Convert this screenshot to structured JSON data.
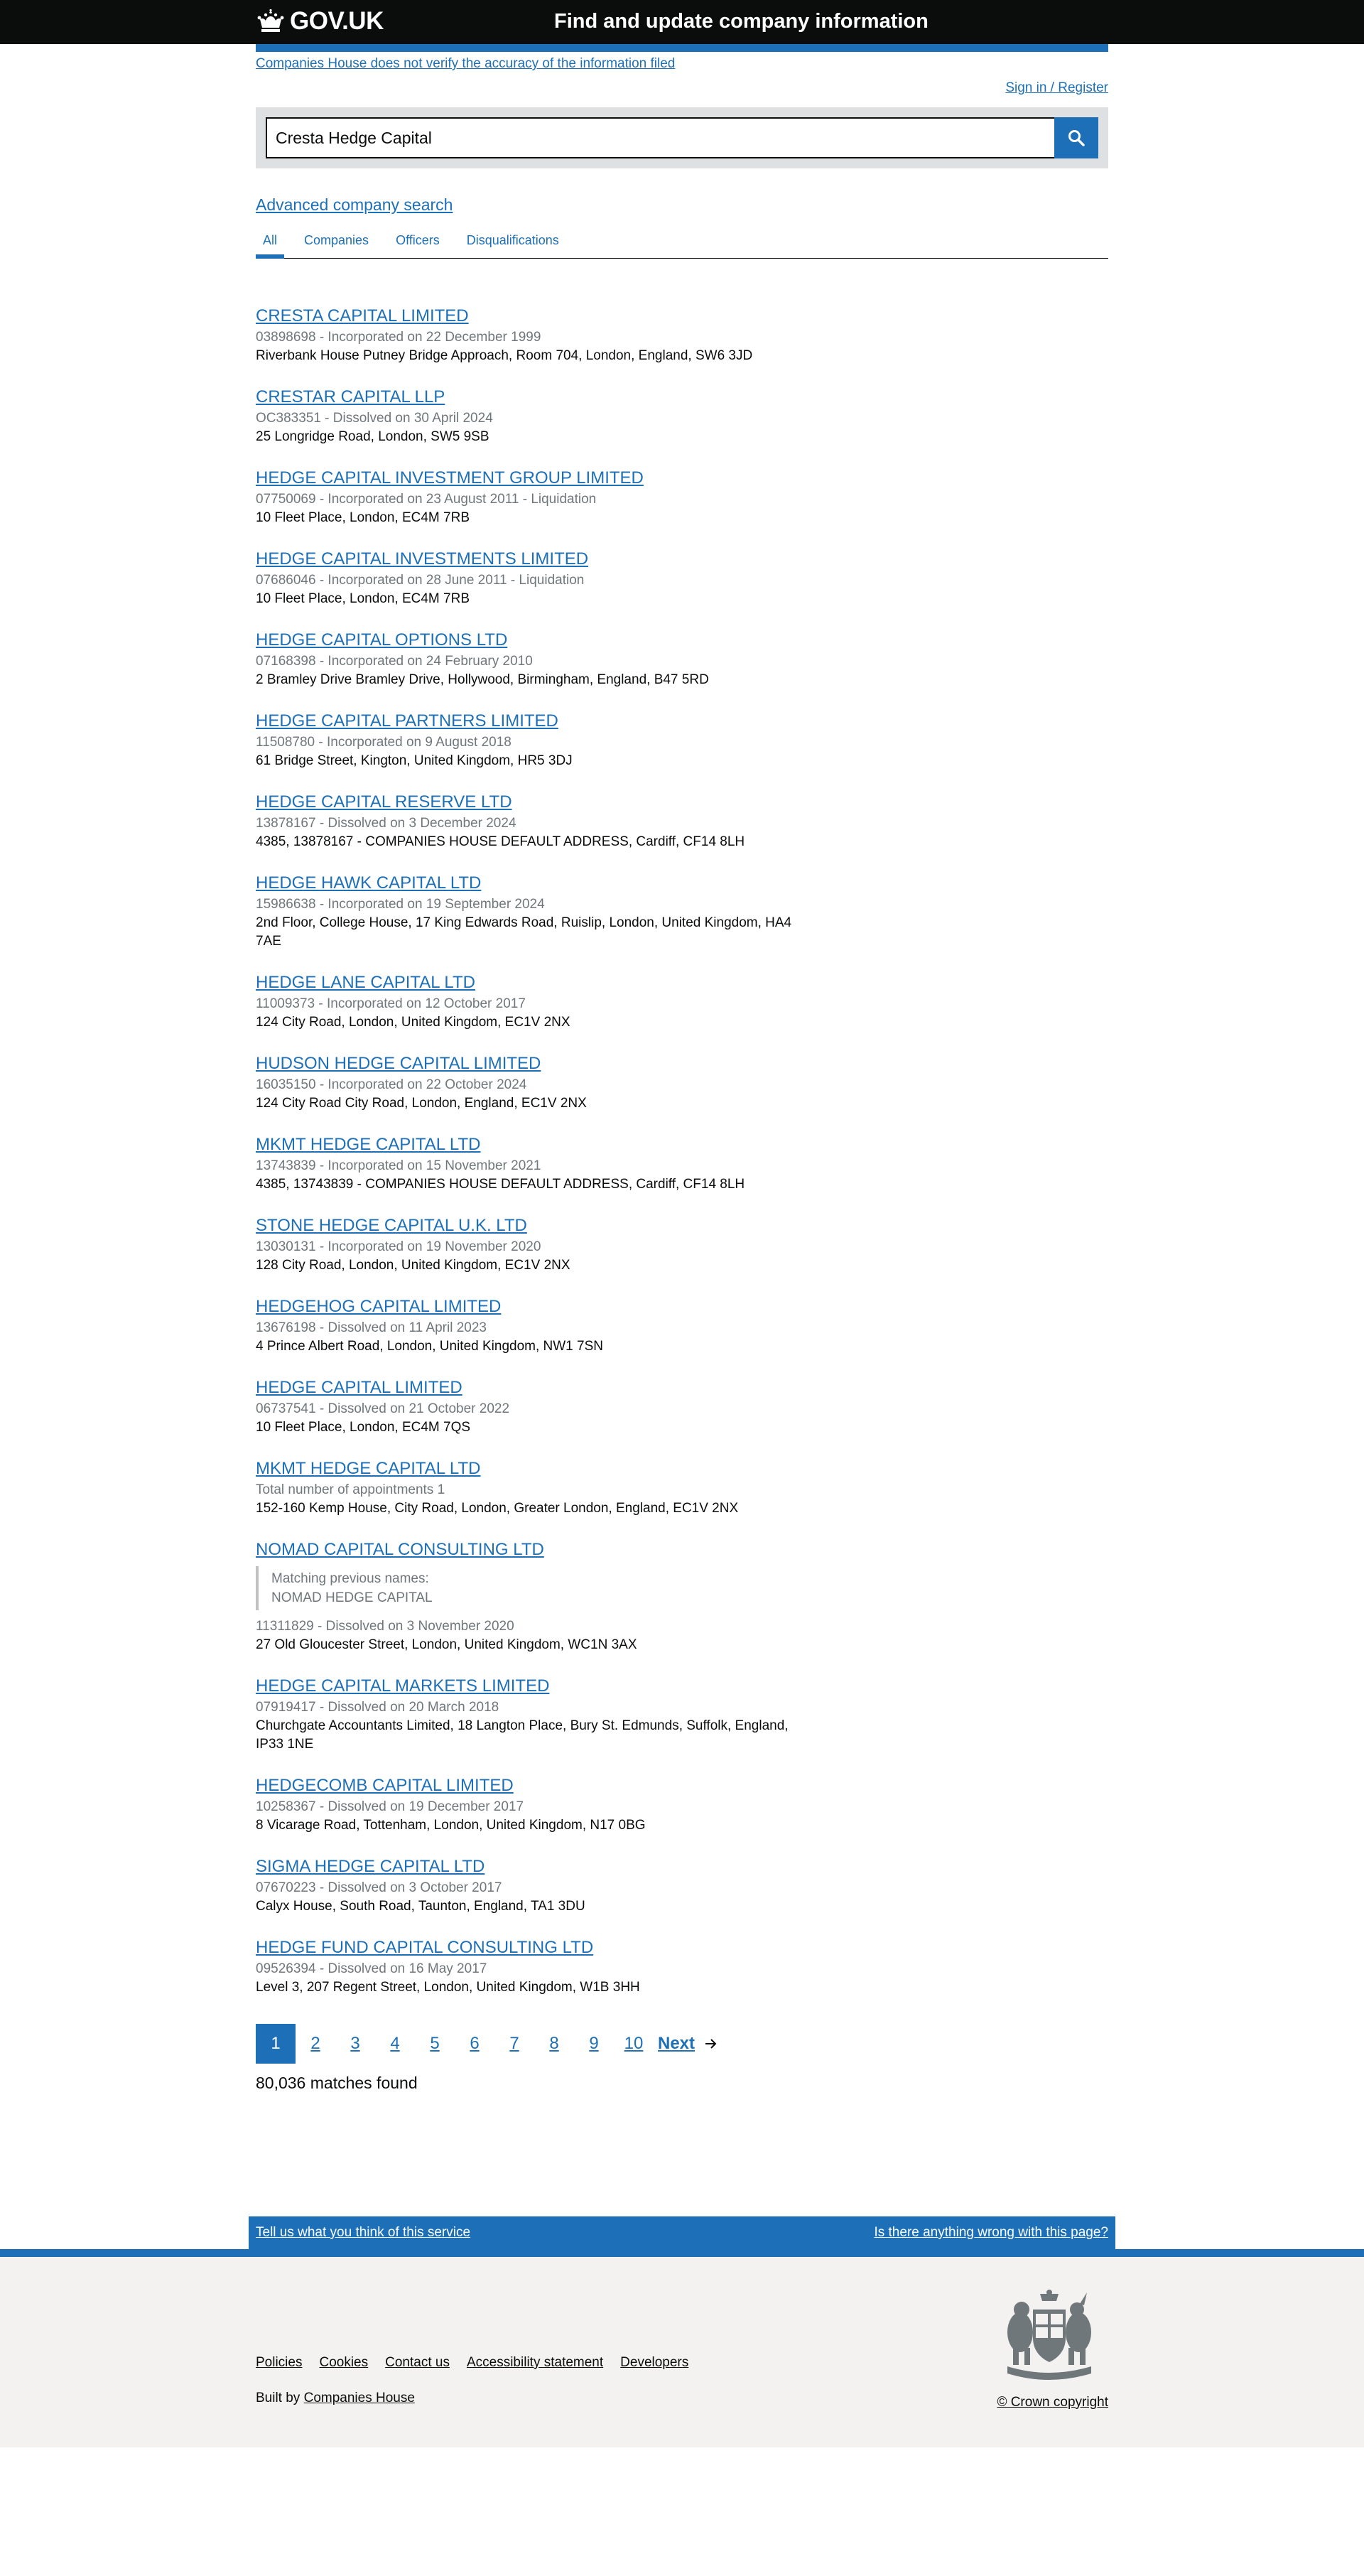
{
  "header": {
    "logo_text": "GOV.UK",
    "service_name": "Find and update company information"
  },
  "banner": {
    "disclaimer": "Companies House does not verify the accuracy of the information filed",
    "sign_in": "Sign in / Register"
  },
  "search": {
    "value": "Cresta Hedge Capital",
    "button_icon": "search-icon"
  },
  "advanced_search": "Advanced company search",
  "tabs": [
    {
      "label": "All",
      "active": true
    },
    {
      "label": "Companies",
      "active": false
    },
    {
      "label": "Officers",
      "active": false
    },
    {
      "label": "Disqualifications",
      "active": false
    }
  ],
  "results": [
    {
      "title": "CRESTA CAPITAL LIMITED",
      "meta": "03898698 - Incorporated on 22 December 1999",
      "address": "Riverbank House Putney Bridge Approach, Room 704, London, England, SW6 3JD"
    },
    {
      "title": "CRESTAR CAPITAL LLP",
      "meta": "OC383351 - Dissolved on 30 April 2024",
      "address": "25 Longridge Road, London, SW5 9SB"
    },
    {
      "title": "HEDGE CAPITAL INVESTMENT GROUP LIMITED",
      "meta": "07750069 - Incorporated on 23 August 2011 - Liquidation",
      "address": "10 Fleet Place, London, EC4M 7RB"
    },
    {
      "title": "HEDGE CAPITAL INVESTMENTS LIMITED",
      "meta": "07686046 - Incorporated on 28 June 2011 - Liquidation",
      "address": "10 Fleet Place, London, EC4M 7RB"
    },
    {
      "title": "HEDGE CAPITAL OPTIONS LTD",
      "meta": "07168398 - Incorporated on 24 February 2010",
      "address": "2 Bramley Drive Bramley Drive, Hollywood, Birmingham, England, B47 5RD"
    },
    {
      "title": "HEDGE CAPITAL PARTNERS LIMITED",
      "meta": "11508780 - Incorporated on 9 August 2018",
      "address": "61 Bridge Street, Kington, United Kingdom, HR5 3DJ"
    },
    {
      "title": "HEDGE CAPITAL RESERVE LTD",
      "meta": "13878167 - Dissolved on 3 December 2024",
      "address": "4385, 13878167 - COMPANIES HOUSE DEFAULT ADDRESS, Cardiff, CF14 8LH"
    },
    {
      "title": "HEDGE HAWK CAPITAL LTD",
      "meta": "15986638 - Incorporated on 19 September 2024",
      "address": "2nd Floor, College House, 17 King Edwards Road, Ruislip, London, United Kingdom, HA4 7AE"
    },
    {
      "title": "HEDGE LANE CAPITAL LTD",
      "meta": "11009373 - Incorporated on 12 October 2017",
      "address": "124 City Road, London, United Kingdom, EC1V 2NX"
    },
    {
      "title": "HUDSON HEDGE CAPITAL LIMITED",
      "meta": "16035150 - Incorporated on 22 October 2024",
      "address": "124 City Road City Road, London, England, EC1V 2NX"
    },
    {
      "title": "MKMT HEDGE CAPITAL LTD",
      "meta": "13743839 - Incorporated on 15 November 2021",
      "address": "4385, 13743839 - COMPANIES HOUSE DEFAULT ADDRESS, Cardiff, CF14 8LH"
    },
    {
      "title": "STONE HEDGE CAPITAL U.K. LTD",
      "meta": "13030131 - Incorporated on 19 November 2020",
      "address": "128 City Road, London, United Kingdom, EC1V 2NX"
    },
    {
      "title": "HEDGEHOG CAPITAL LIMITED",
      "meta": "13676198 - Dissolved on 11 April 2023",
      "address": "4 Prince Albert Road, London, United Kingdom, NW1 7SN"
    },
    {
      "title": "HEDGE CAPITAL LIMITED",
      "meta": "06737541 - Dissolved on 21 October 2022",
      "address": "10 Fleet Place, London, EC4M 7QS"
    },
    {
      "title": "MKMT HEDGE CAPITAL LTD",
      "meta": "Total number of appointments 1",
      "address": "152-160 Kemp House, City Road, London, Greater London, England, EC1V 2NX"
    },
    {
      "title": "NOMAD CAPITAL CONSULTING LTD",
      "prev_label": "Matching previous names:",
      "prev_name": "NOMAD HEDGE CAPITAL",
      "meta": "11311829 - Dissolved on 3 November 2020",
      "address": "27 Old Gloucester Street, London, United Kingdom, WC1N 3AX"
    },
    {
      "title": "HEDGE CAPITAL MARKETS LIMITED",
      "meta": "07919417 - Dissolved on 20 March 2018",
      "address": "Churchgate Accountants Limited, 18 Langton Place, Bury St. Edmunds, Suffolk, England, IP33 1NE"
    },
    {
      "title": "HEDGECOMB CAPITAL LIMITED",
      "meta": "10258367 - Dissolved on 19 December 2017",
      "address": "8 Vicarage Road, Tottenham, London, United Kingdom, N17 0BG"
    },
    {
      "title": "SIGMA HEDGE CAPITAL LTD",
      "meta": "07670223 - Dissolved on 3 October 2017",
      "address": "Calyx House, South Road, Taunton, England, TA1 3DU"
    },
    {
      "title": "HEDGE FUND CAPITAL CONSULTING LTD",
      "meta": "09526394 - Dissolved on 16 May 2017",
      "address": "Level 3, 207 Regent Street, London, United Kingdom, W1B 3HH"
    }
  ],
  "pagination": {
    "pages": [
      "1",
      "2",
      "3",
      "4",
      "5",
      "6",
      "7",
      "8",
      "9",
      "10"
    ],
    "current": "1",
    "next_label": "Next",
    "next_icon": "arrow-right-icon",
    "matches": "80,036 matches found"
  },
  "feedback": {
    "left": "Tell us what you think of this service",
    "right": "Is there anything wrong with this page?"
  },
  "footer": {
    "links": [
      "Policies",
      "Cookies",
      "Contact us",
      "Accessibility statement",
      "Developers"
    ],
    "built_by_prefix": "Built by ",
    "built_by_link": "Companies House",
    "copyright": "© Crown copyright",
    "crest_icon": "royal-coat-of-arms-icon"
  },
  "colors": {
    "header_bg": "#0b0c0c",
    "link": "#1d70b8",
    "accent": "#1d70b8",
    "muted_text": "#6f777b",
    "footer_bg": "#f3f2f1",
    "search_panel_bg": "#dee0e2"
  }
}
